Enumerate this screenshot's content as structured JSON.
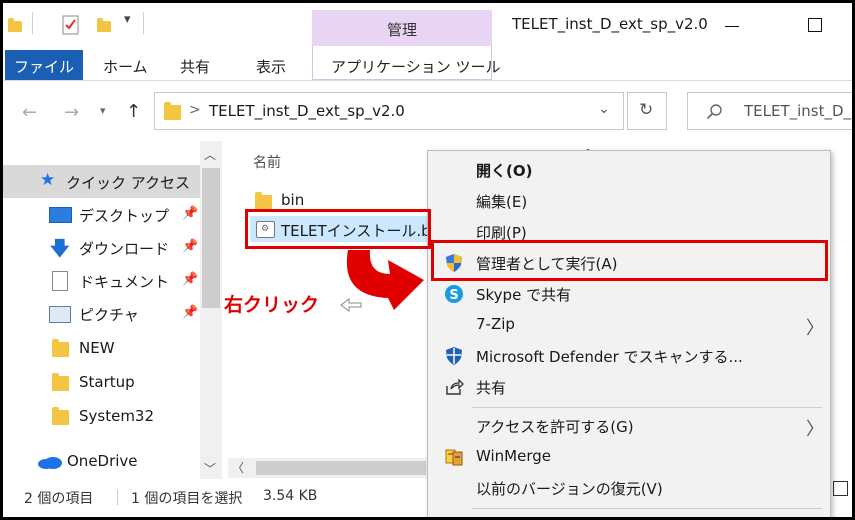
{
  "window": {
    "title": "TELET_inst_D_ext_sp_v2.0",
    "context_tab_header": "管理"
  },
  "ribbon": {
    "tabs": [
      "ファイル",
      "ホーム",
      "共有",
      "表示",
      "アプリケーション ツール"
    ]
  },
  "nav": {
    "address_separator": ">",
    "address_path": "TELET_inst_D_ext_sp_v2.0",
    "search_placeholder": "TELET_inst_D_e"
  },
  "sidebar": {
    "quick_access": "クイック アクセス",
    "items": [
      "デスクトップ",
      "ダウンロード",
      "ドキュメント",
      "ピクチャ",
      "NEW",
      "Startup",
      "System32"
    ],
    "onedrive": "OneDrive"
  },
  "main": {
    "column_header": "名前",
    "files": [
      "bin",
      "TELETインストール.bat"
    ]
  },
  "status": {
    "item_count": "2 個の項目",
    "selection": "1 個の項目を選択",
    "size": "3.54 KB"
  },
  "context_menu": {
    "items": [
      "開く(O)",
      "編集(E)",
      "印刷(P)",
      "管理者として実行(A)",
      "Skype で共有",
      "7-Zip",
      "Microsoft Defender でスキャンする...",
      "共有",
      "アクセスを許可する(G)",
      "WinMerge",
      "以前のバージョンの復元(V)"
    ]
  },
  "annotation": {
    "label": "右クリック"
  },
  "colors": {
    "file_tab": "#1a5fb4",
    "context_tab": "#e8d5f4",
    "selection": "#cce8ff",
    "annotation_red": "#e00000",
    "folder": "#f4c542"
  }
}
